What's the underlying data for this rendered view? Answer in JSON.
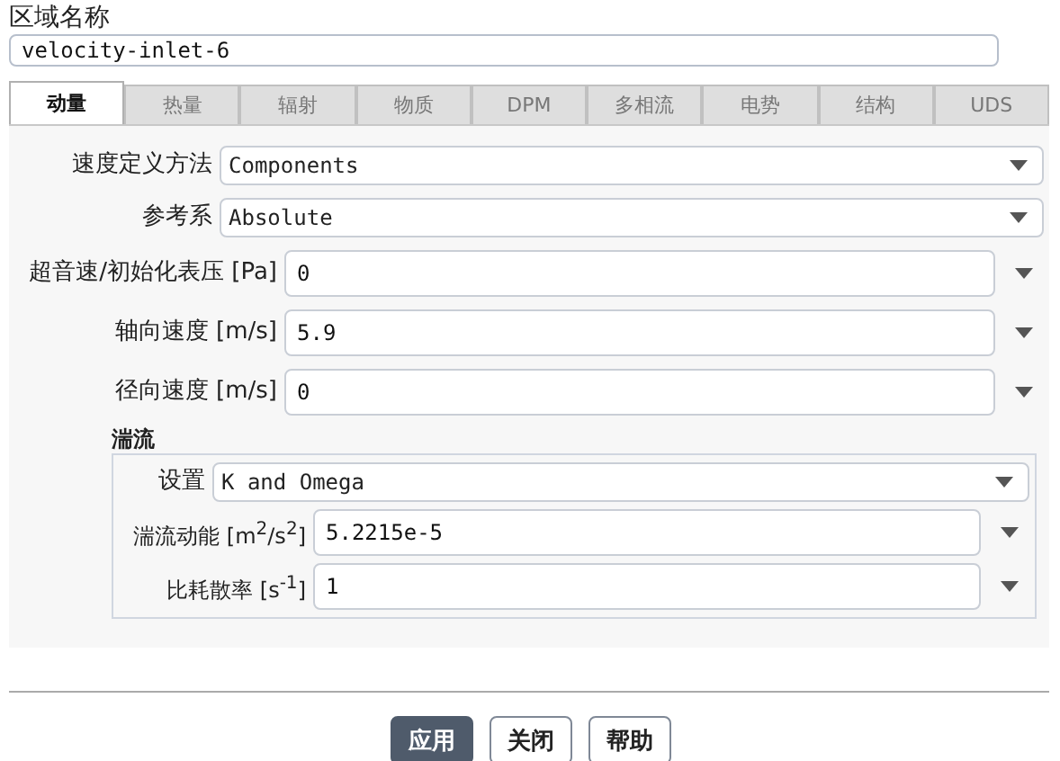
{
  "zone_name": {
    "label": "区域名称",
    "value": "velocity-inlet-6"
  },
  "tabs": [
    {
      "label": "动量",
      "selected": true
    },
    {
      "label": "热量",
      "selected": false
    },
    {
      "label": "辐射",
      "selected": false
    },
    {
      "label": "物质",
      "selected": false
    },
    {
      "label": "DPM",
      "selected": false
    },
    {
      "label": "多相流",
      "selected": false
    },
    {
      "label": "电势",
      "selected": false
    },
    {
      "label": "结构",
      "selected": false
    },
    {
      "label": "UDS",
      "selected": false
    }
  ],
  "fields": [
    {
      "kind": "dropdown",
      "label": "速度定义方法",
      "value": "Components"
    },
    {
      "kind": "dropdown",
      "label": "参考系",
      "value": "Absolute"
    },
    {
      "kind": "value",
      "label": "超音速/初始化表压",
      "unit": "[Pa]",
      "value": "0"
    },
    {
      "kind": "value",
      "label": "轴向速度",
      "unit": "[m/s]",
      "value": "5.9"
    },
    {
      "kind": "value",
      "label": "径向速度",
      "unit": "[m/s]",
      "value": "0"
    }
  ],
  "turbulence": {
    "title": "湍流",
    "fields": [
      {
        "kind": "dropdown",
        "label": "设置",
        "value": "K and Omega"
      },
      {
        "kind": "value",
        "label": "湍流动能",
        "unit": "[m$^{2}$/s$^{2}$]",
        "value": "5.2215e-5"
      },
      {
        "kind": "value",
        "label": "比耗散率",
        "unit": "[s$^{-1}$]",
        "value": "1"
      }
    ]
  },
  "buttons": [
    {
      "label": "应用",
      "kind": "primary"
    },
    {
      "label": "关闭",
      "kind": "plain"
    },
    {
      "label": "帮助",
      "kind": "plain"
    }
  ]
}
